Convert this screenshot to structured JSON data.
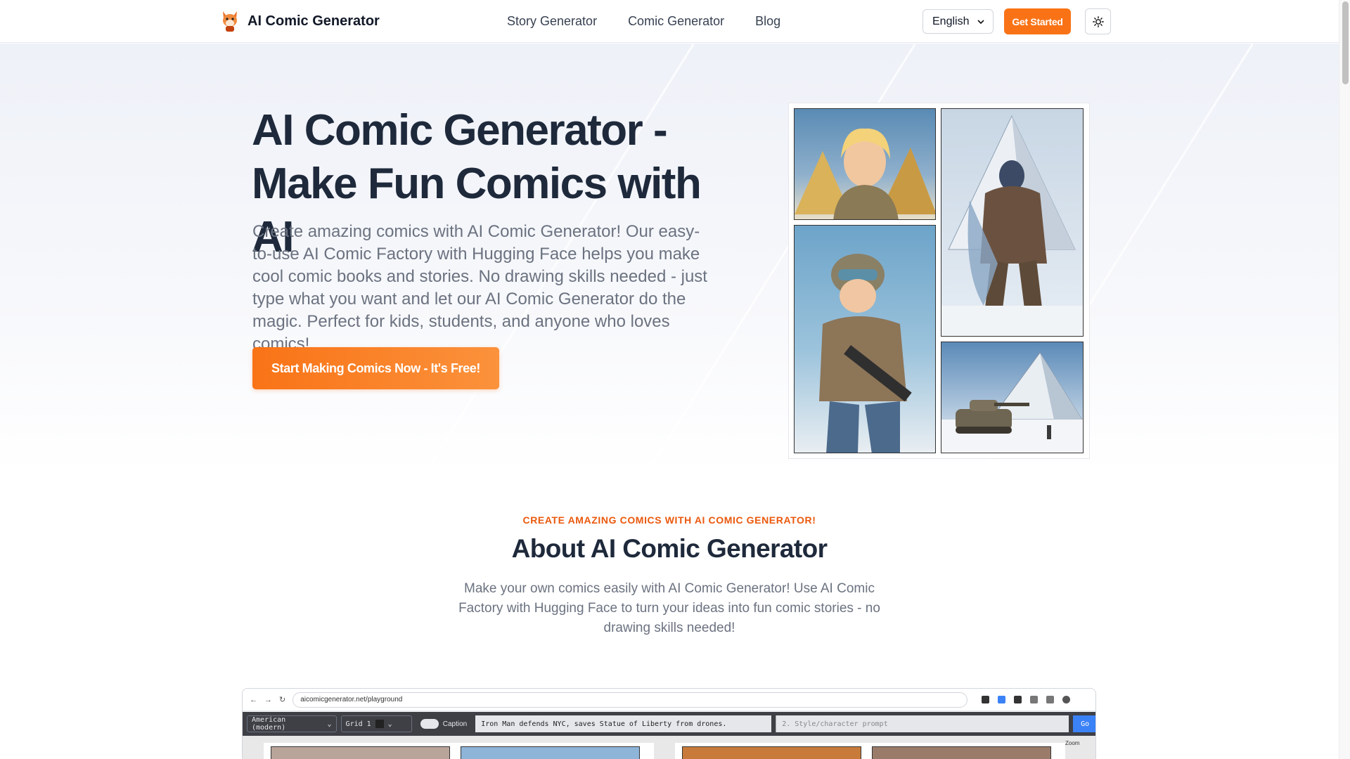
{
  "nav": {
    "brand": "AI Comic Generator",
    "links": [
      "Story Generator",
      "Comic Generator",
      "Blog"
    ],
    "language": "English",
    "get_started": "Get Started"
  },
  "hero": {
    "title_line1": "AI Comic Generator -",
    "title_line2": "Make Fun Comics with AI",
    "description": "Create amazing comics with AI Comic Generator! Our easy-to-use AI Comic Factory with Hugging Face helps you make cool comic books and stories. No drawing skills needed - just type what you want and let our AI Comic Generator do the magic. Perfect for kids, students, and anyone who loves comics!",
    "cta": "Start Making Comics Now - It's Free!"
  },
  "about": {
    "eyebrow": "CREATE AMAZING COMICS WITH AI COMIC GENERATOR!",
    "title": "About AI Comic Generator",
    "description": "Make your own comics easily with AI Comic Generator! Use AI Comic Factory with Hugging Face to turn your ideas into fun comic stories - no drawing skills needed!"
  },
  "screenshot": {
    "url": "aicomicgenerator.net/playground",
    "style_select": "American (modern)",
    "grid_select": "Grid 1",
    "caption_label": "Caption",
    "prompt": "Iron Man defends NYC, saves Statue of Liberty from drones.",
    "style_placeholder": "2. Style/character prompt",
    "go": "Go",
    "zoom": "Zoom"
  },
  "colors": {
    "accent": "#f97316",
    "text_dark": "#1e293b",
    "text_muted": "#6b7280"
  }
}
